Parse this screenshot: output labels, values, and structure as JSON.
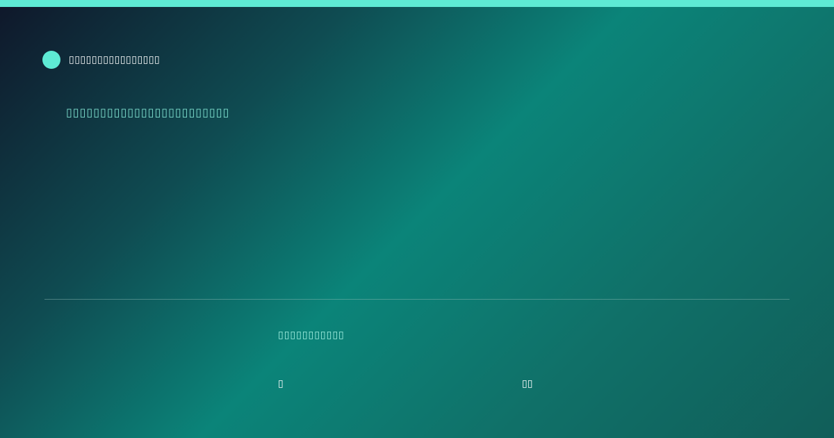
{
  "colors": {
    "accent": "#5eead4",
    "headline": "#7ee0cf",
    "label": "#a7f3e4",
    "text": "#ffffff"
  },
  "brand": {
    "icon": "accent-circle-icon",
    "name": "▯▯▯▯▯▯▯▯▯▯▯▯▯▯▯▯"
  },
  "headline": "▯▯▯▯▯▯▯▯▯▯▯▯▯▯▯▯▯▯▯▯▯▯▯▯",
  "footer": {
    "label": "▯▯▯▯▯▯▯▯▯▯▯",
    "stat_left": "▯",
    "stat_right": "▯▯"
  }
}
